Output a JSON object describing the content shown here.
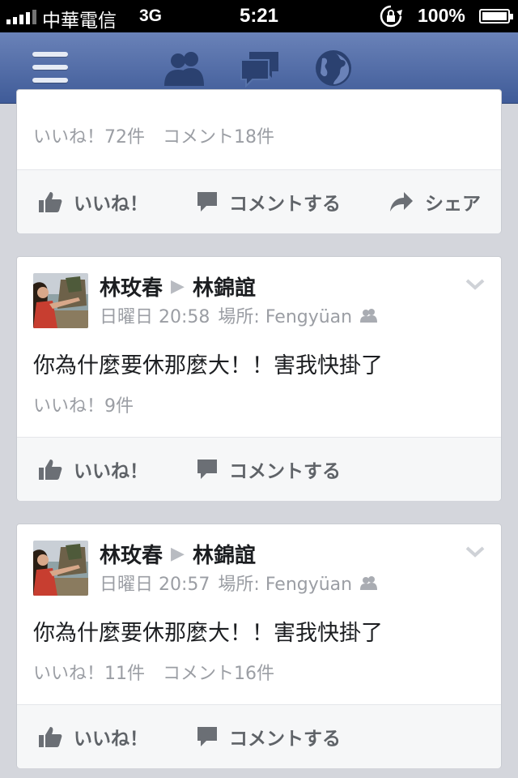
{
  "status_bar": {
    "carrier": "中華電信",
    "network": "3G",
    "time": "5:21",
    "battery": "100%"
  },
  "nav": {
    "icons": [
      "menu-icon",
      "friends-icon",
      "messages-icon",
      "globe-icon"
    ]
  },
  "posts": [
    {
      "stats": {
        "likes": "いいね！72件",
        "comments": "コメント18件"
      },
      "actions": {
        "like": "いいね！",
        "comment": "コメントする",
        "share": "シェア"
      }
    },
    {
      "author": "林玫春",
      "target": "林錦誼",
      "day": "日曜日",
      "time": "20:58",
      "location": "場所: Fengyüan",
      "body": "你為什麼要休那麼大！！害我快掛了",
      "stats": {
        "likes": "いいね！9件",
        "comments": ""
      },
      "actions": {
        "like": "いいね！",
        "comment": "コメントする"
      }
    },
    {
      "author": "林玫春",
      "target": "林錦誼",
      "day": "日曜日",
      "time": "20:57",
      "location": "場所: Fengyüan",
      "body": "你為什麼要休那麼大！！害我快掛了",
      "stats": {
        "likes": "いいね！11件",
        "comments": "コメント16件"
      },
      "actions": {
        "like": "いいね！",
        "comment": "コメントする"
      }
    }
  ],
  "colors": {
    "nav_top": "#6a82b8",
    "nav_bottom": "#3f5b98",
    "background": "#d4d6dc"
  }
}
